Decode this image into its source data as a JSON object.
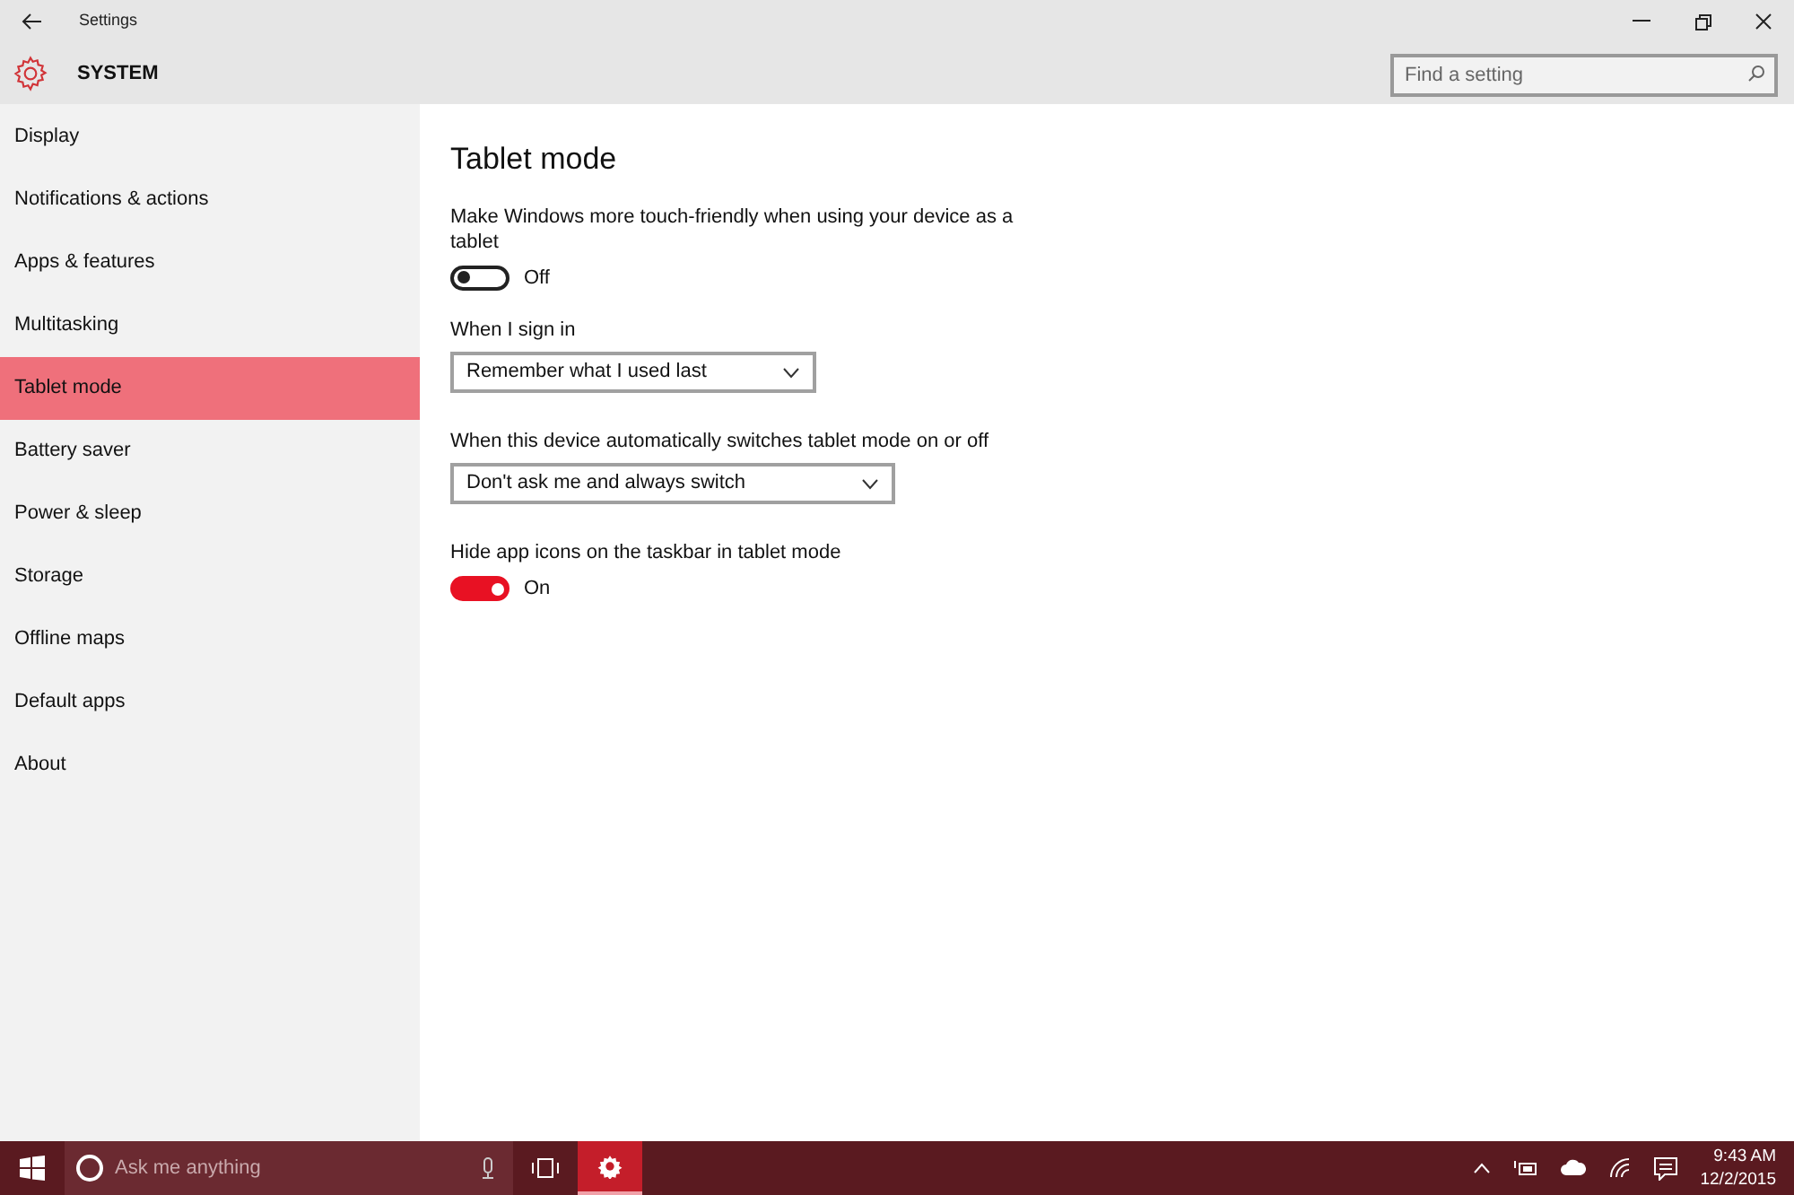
{
  "window": {
    "title": "Settings"
  },
  "header": {
    "section": "SYSTEM",
    "search": {
      "placeholder": "Find a setting"
    }
  },
  "sidebar": {
    "items": [
      {
        "label": "Display",
        "selected": false
      },
      {
        "label": "Notifications & actions",
        "selected": false
      },
      {
        "label": "Apps & features",
        "selected": false
      },
      {
        "label": "Multitasking",
        "selected": false
      },
      {
        "label": "Tablet mode",
        "selected": true
      },
      {
        "label": "Battery saver",
        "selected": false
      },
      {
        "label": "Power & sleep",
        "selected": false
      },
      {
        "label": "Storage",
        "selected": false
      },
      {
        "label": "Offline maps",
        "selected": false
      },
      {
        "label": "Default apps",
        "selected": false
      },
      {
        "label": "About",
        "selected": false
      }
    ]
  },
  "page": {
    "title": "Tablet mode",
    "settings": [
      {
        "kind": "toggle",
        "label": "Make Windows more touch-friendly when using your device as a tablet",
        "on": false,
        "state_label": "Off"
      },
      {
        "kind": "dropdown",
        "label": "When I sign in",
        "value": "Remember what I used last"
      },
      {
        "kind": "dropdown",
        "label": "When this device automatically switches tablet mode on or off",
        "value": "Don't ask me and always switch"
      },
      {
        "kind": "toggle",
        "label": "Hide app icons on the taskbar in tablet mode",
        "on": true,
        "state_label": "On"
      }
    ]
  },
  "taskbar": {
    "search": {
      "placeholder": "Ask me anything"
    },
    "settings_app": {
      "active": true
    },
    "clock": {
      "time": "9:43 AM",
      "date": "12/2/2015"
    }
  }
}
